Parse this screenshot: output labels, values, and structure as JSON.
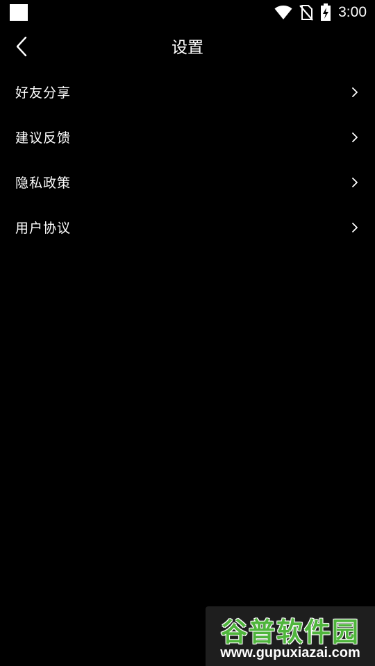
{
  "status_bar": {
    "time": "3:00",
    "icons": [
      "notification-square-icon",
      "wifi-icon",
      "no-sim-icon",
      "battery-charging-icon"
    ]
  },
  "header": {
    "title": "设置",
    "back_icon": "back-chevron-icon"
  },
  "menu": {
    "items": [
      {
        "label": "好友分享",
        "icon": "chevron-right-icon"
      },
      {
        "label": "建议反馈",
        "icon": "chevron-right-icon"
      },
      {
        "label": "隐私政策",
        "icon": "chevron-right-icon"
      },
      {
        "label": "用户协议",
        "icon": "chevron-right-icon"
      }
    ]
  },
  "watermark": {
    "title": "谷普软件园",
    "url": "www.gupuxiazai.com",
    "color": "#4fb53c"
  },
  "colors": {
    "background": "#000000",
    "text": "#ffffff"
  }
}
